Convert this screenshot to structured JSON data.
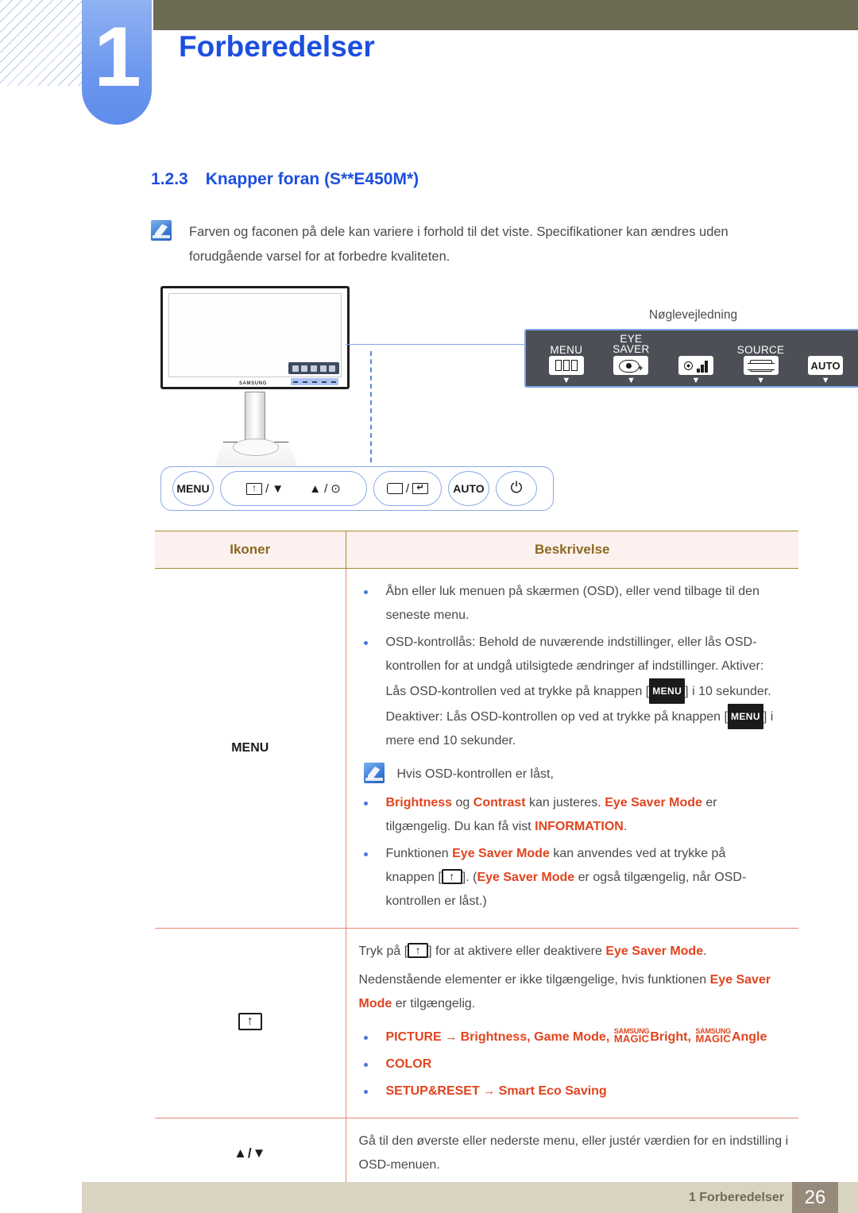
{
  "chapter": {
    "number": "1",
    "title": "Forberedelser"
  },
  "section": {
    "number": "1.2.3",
    "title": "Knapper foran (S**E450M*)"
  },
  "note": {
    "icon": "note-pencil-icon",
    "text": "Farven og faconen på dele kan variere i forhold til det viste. Specifikationer kan ændres uden forudgående varsel for at forbedre kvaliteten."
  },
  "figure": {
    "monitor_brand": "SAMSUNG",
    "keyguide_label": "Nøglevejledning",
    "keyguide_buttons": [
      {
        "label_line1": "",
        "label_line2": "MENU",
        "icon": "menu-bars-icon",
        "caret": "▼"
      },
      {
        "label_line1": "EYE",
        "label_line2": "SAVER",
        "icon": "eye-saver-icon",
        "caret": "▼"
      },
      {
        "label_line1": "",
        "label_line2": "",
        "icon": "brightness-icon",
        "caret": "▼"
      },
      {
        "label_line1": "",
        "label_line2": "SOURCE",
        "icon": "source-icon",
        "caret": "▼"
      },
      {
        "label_line1": "",
        "label_line2": "",
        "icon": "auto-icon",
        "auto_text": "AUTO",
        "caret": "▼"
      }
    ],
    "front_buttons": [
      {
        "type": "circle",
        "label": "MENU",
        "name": "menu-button"
      },
      {
        "type": "pill",
        "name": "eye-saver-down-up-enter-button",
        "segments": [
          {
            "icon": "eye-saver-arrow-icon",
            "sep": "/",
            "glyph": "▼"
          },
          {
            "glyph": "▲",
            "sep": "/",
            "icon": "enter-dot-icon"
          }
        ]
      },
      {
        "type": "pill",
        "name": "source-return-button",
        "segments": [
          {
            "icon": "source-rect-icon",
            "sep": "/",
            "icon2": "return-icon"
          }
        ]
      },
      {
        "type": "circle",
        "label": "AUTO",
        "name": "auto-button"
      },
      {
        "type": "circle",
        "label": "⏻",
        "name": "power-button"
      }
    ]
  },
  "table": {
    "headers": {
      "icons": "Ikoner",
      "description": "Beskrivelse"
    },
    "rows": [
      {
        "icon_label": "MENU",
        "icon_name": "menu-label-icon",
        "bullets": [
          "Åbn eller luk menuen på skærmen (OSD), eller vend tilbage til den seneste menu.",
          "OSD-kontrollås: Behold de nuværende indstillinger, eller lås OSD-kontrollen for at undgå utilsigtede ændringer af indstillinger. Aktiver: Lås OSD-kontrollen ved at trykke på knappen [MENU] i 10 sekunder. Deaktiver: Lås OSD-kontrollen op ved at trykke på knappen [MENU] i mere end 10 sekunder."
        ],
        "note": "Hvis OSD-kontrollen er låst,",
        "sub_bullets": [
          "Brightness og Contrast kan justeres. Eye Saver Mode er tilgængelig. Du kan få vist INFORMATION.",
          "Funktionen Eye Saver Mode kan anvendes ved at trykke på knappen [↑]. (Eye Saver Mode er også tilgængelig, når OSD-kontrollen er låst.)"
        ]
      },
      {
        "icon_label": "",
        "icon_name": "eye-saver-mode-icon",
        "intro": "Tryk på [↑] for at aktivere eller deaktivere Eye Saver Mode.",
        "second": "Nedenstående elementer er ikke tilgængelige, hvis funktionen Eye Saver Mode er tilgængelig.",
        "menu_bullets": [
          "PICTURE → Brightness, Game Mode, SAMSUNG MAGIC Bright, SAMSUNG MAGIC Angle",
          "COLOR",
          "SETUP&RESET → Smart Eco Saving"
        ]
      },
      {
        "icon_label": "▲/▼",
        "icon_name": "up-down-arrows-icon",
        "description": "Gå til den øverste eller nederste menu, eller justér værdien for en indstilling i OSD-menuen."
      }
    ],
    "strings": {
      "brightness": "Brightness",
      "contrast": "Contrast",
      "eye_saver_mode": "Eye Saver Mode",
      "information": "INFORMATION",
      "picture": "PICTURE",
      "game_mode": "Game Mode",
      "color": "COLOR",
      "setup_reset": "SETUP&RESET",
      "smart_eco_saving": "Smart Eco Saving",
      "magic_top": "SAMSUNG",
      "magic_bottom": "MAGIC",
      "magic_bright": "Bright",
      "magic_angle": "Angle",
      "arrow": "→",
      "og": "og",
      "kan_justeres": "kan justeres.",
      "er": "er",
      "tilg_du_kan": "tilgængelig. Du kan få vist",
      "funktionen": "Funktionen",
      "kan_anvendes": "kan anvendes ved at trykke på",
      "knappen": "knappen [",
      "ogsaa_tilg": "er også tilgængelig, når OSD-",
      "kontrollen_laast": "kontrollen er låst.)",
      "tryk_paa": "Tryk på [",
      "for_at_aktivere": "] for at aktivere eller deaktivere",
      "neden1": "Nedenstående elementer er ikke tilgængelige, hvis funktionen",
      "neden2": "er tilgængelig.",
      "mode_word": "Mode",
      "eye_saver_words": "Eye Saver",
      "period": ".",
      "comma": ",",
      "osd_line1": "Åbn eller luk menuen på skærmen (OSD), eller vend tilbage til den",
      "osd_line2": "seneste menu.",
      "lock_line1": "OSD-kontrollås: Behold de nuværende indstillinger, eller lås OSD-",
      "lock_line2": "kontrollen for at undgå utilsigtede ændringer af indstillinger. Aktiver:",
      "lock_line3a": "Lås OSD-kontrollen ved at trykke på knappen [",
      "lock_line3b": "] i 10 sekunder.",
      "lock_line4a": "Deaktiver: Lås OSD-kontrollen op ved at trykke på knappen [",
      "lock_line4b": "] i",
      "lock_line5": "mere end 10 sekunder.",
      "menu_kbd": "MENU"
    }
  },
  "footer": {
    "chapter_ref": "1 Forberedelser",
    "page": "26"
  },
  "colors": {
    "accent_blue": "#1c4fe0",
    "olive": "#6e6b54",
    "badge_blue": "#6d97ee",
    "highlight_red": "#e0441f",
    "table_border_gold": "#a98b33",
    "table_header_bg": "#fdf1ef",
    "table_row_border": "#e98a6e",
    "footer_bar": "#d9d3c2",
    "footer_page": "#968b7b"
  }
}
